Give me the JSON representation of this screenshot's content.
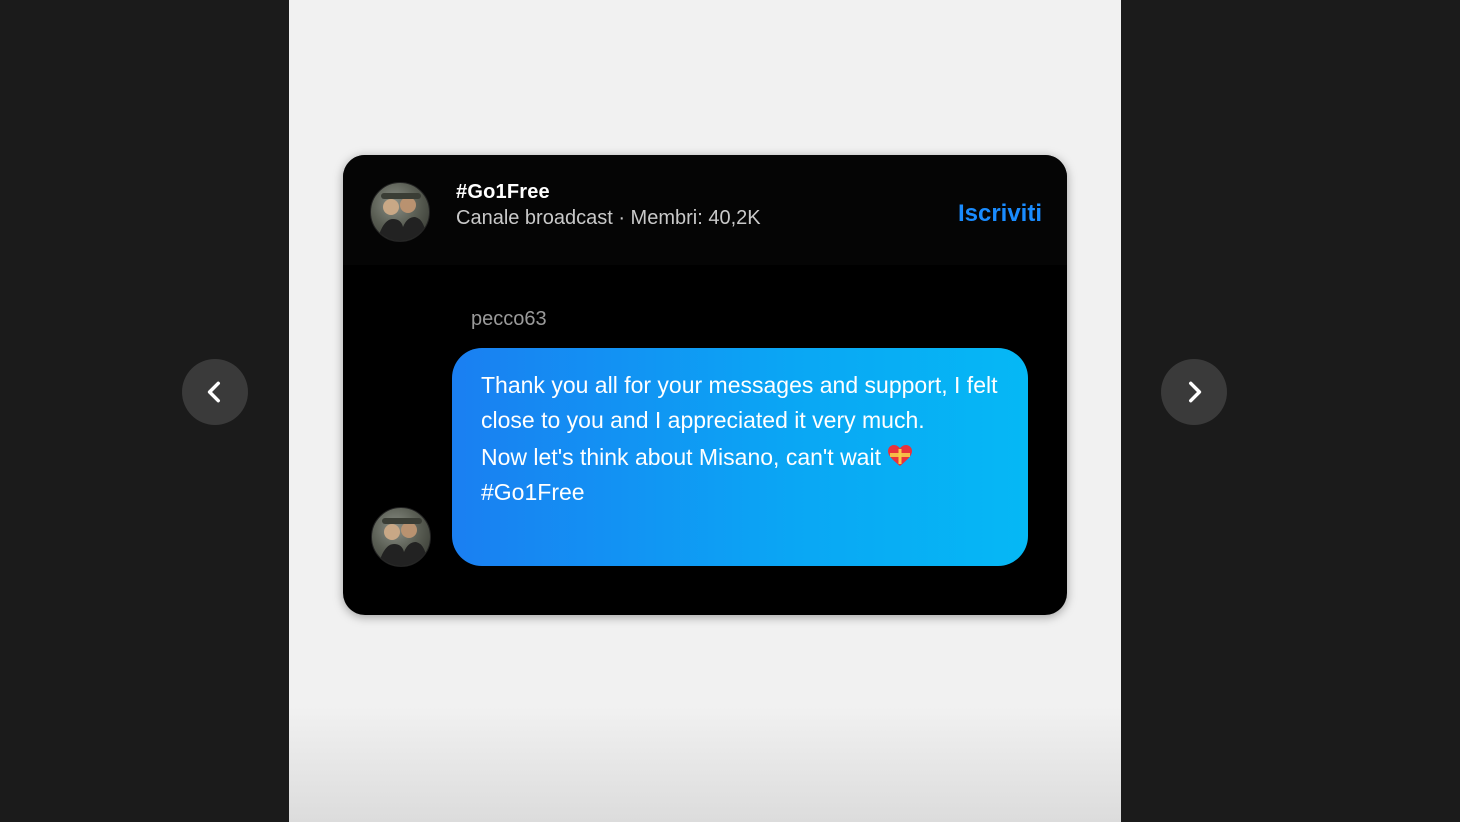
{
  "channel": {
    "name": "#Go1Free",
    "subtitle": "Canale broadcast · Membri: 40,2K",
    "subscribe_label": "Iscriviti"
  },
  "message": {
    "sender": "pecco63",
    "paragraph1": "Thank you all for your messages and support, I felt close to you and I appreciated it very much.",
    "paragraph2": "Now let's think about Misano, can't wait",
    "hashtag": "#Go1Free",
    "emoji": "heart-with-ribbon-icon"
  },
  "navigation": {
    "prev_icon": "chevron-left-icon",
    "next_icon": "chevron-right-icon"
  },
  "colors": {
    "accent": "#1a8cff",
    "bubble_start": "#1a7ff2",
    "bubble_end": "#05b8f5",
    "card_bg": "#000000",
    "viewer_bg": "#1b1b1b",
    "story_bg": "#f1f1f1"
  }
}
